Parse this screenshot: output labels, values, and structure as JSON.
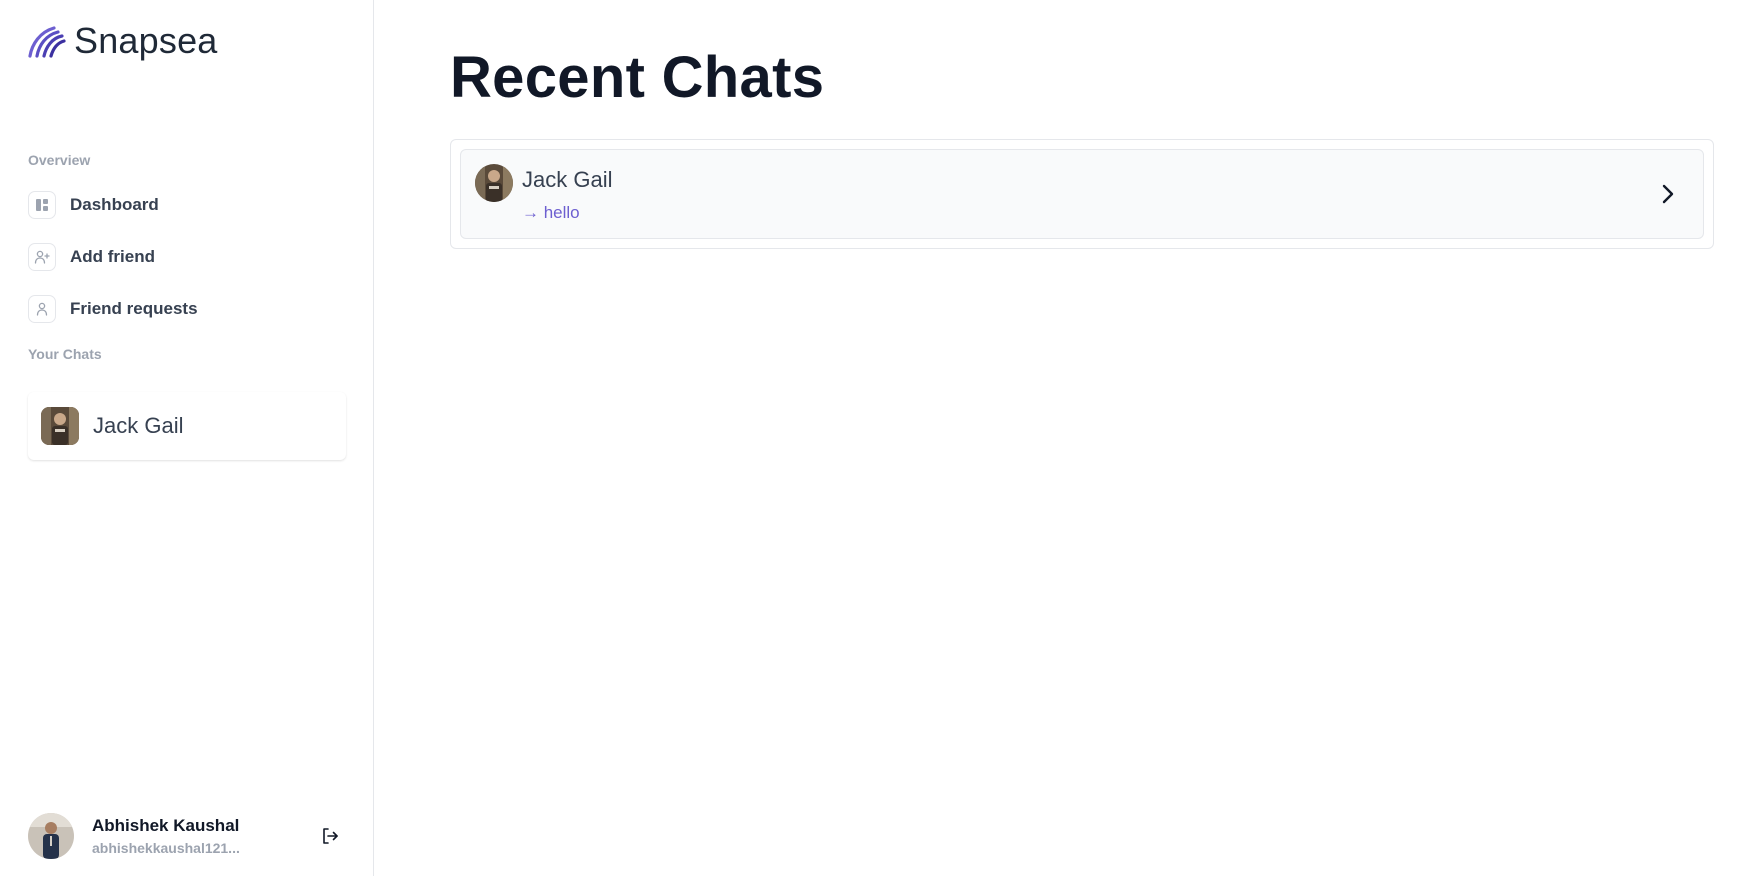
{
  "brand": {
    "name": "Snapsea"
  },
  "sidebar": {
    "overview_label": "Overview",
    "nav": [
      {
        "label": "Dashboard",
        "icon": "layout-icon"
      },
      {
        "label": "Add friend",
        "icon": "user-plus-icon"
      },
      {
        "label": "Friend requests",
        "icon": "user-icon"
      }
    ],
    "chats_label": "Your Chats",
    "chats": [
      {
        "name": "Jack Gail"
      }
    ]
  },
  "profile": {
    "name": "Abhishek Kaushal",
    "email": "abhishekkaushal121..."
  },
  "main": {
    "title": "Recent Chats",
    "recent": [
      {
        "name": "Jack Gail",
        "message": "→ hello"
      }
    ]
  },
  "colors": {
    "accent": "#6d5fd0",
    "text_dark": "#111827",
    "muted": "#9ca3af",
    "border": "#e5e7eb"
  }
}
